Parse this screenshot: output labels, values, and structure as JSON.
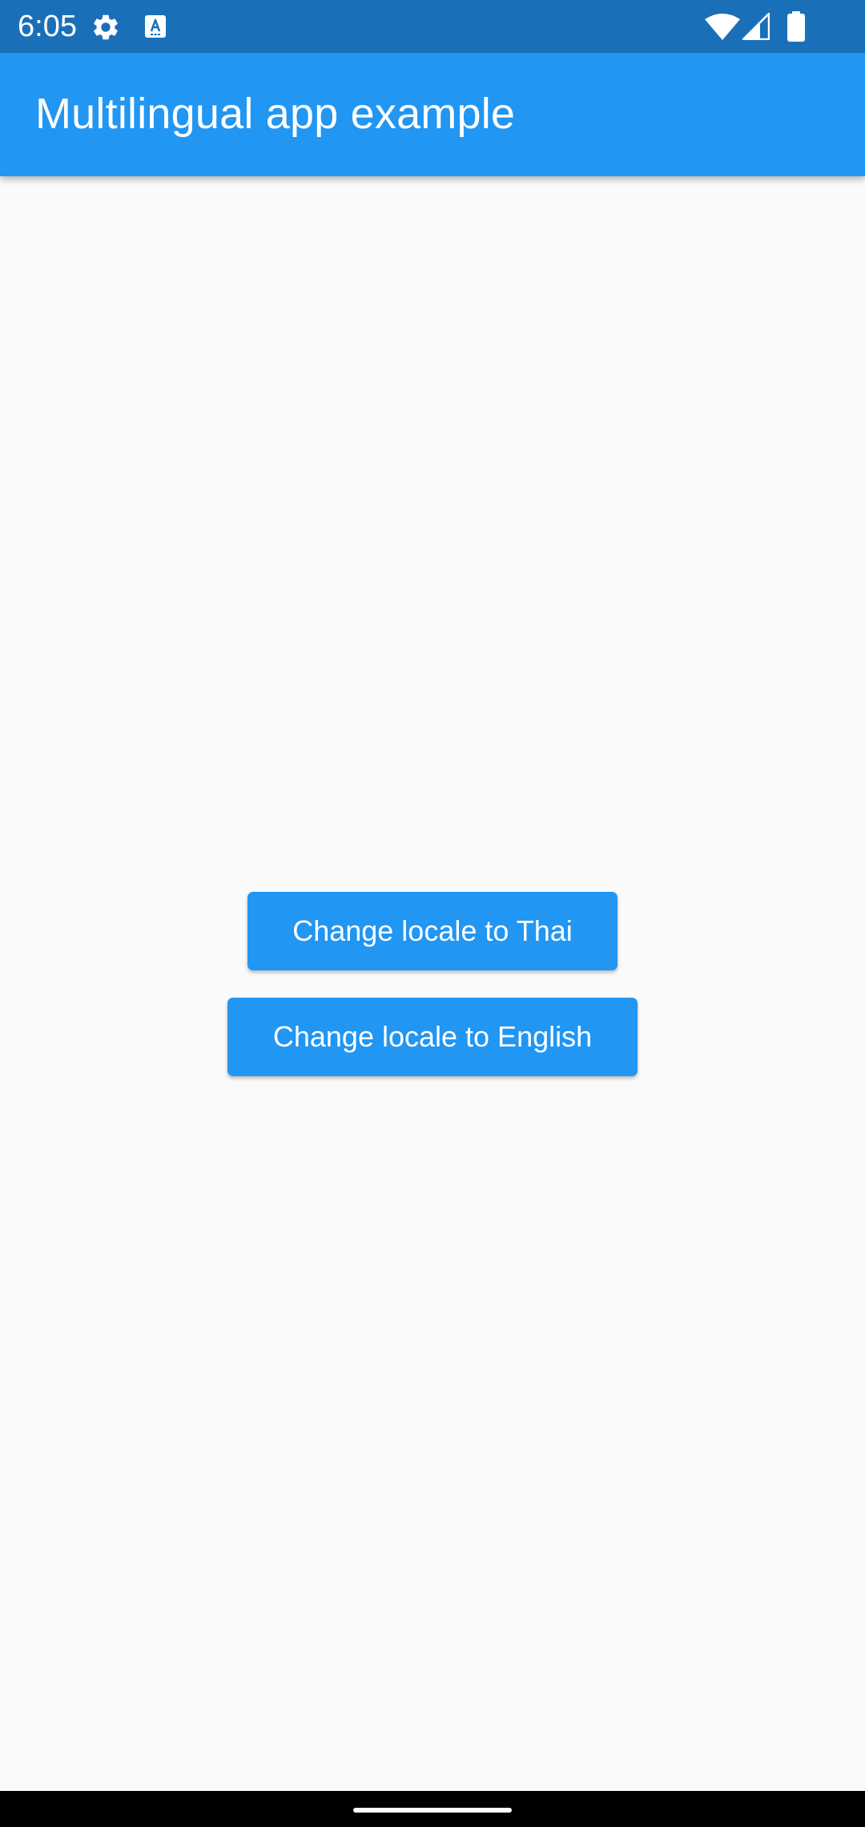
{
  "status_bar": {
    "time": "6:05",
    "background_color": "#1a70b8",
    "icons": [
      "gear-icon",
      "keyboard-a-icon",
      "wifi-icon",
      "signal-icon",
      "battery-icon"
    ]
  },
  "app_bar": {
    "title": "Multilingual app example",
    "background_color": "#2196f3"
  },
  "buttons": {
    "thai_label": "Change locale to Thai",
    "english_label": "Change locale to English",
    "color": "#2196f3"
  },
  "navigation_bar": {
    "background_color": "#000000",
    "handle": "gesture-handle"
  }
}
